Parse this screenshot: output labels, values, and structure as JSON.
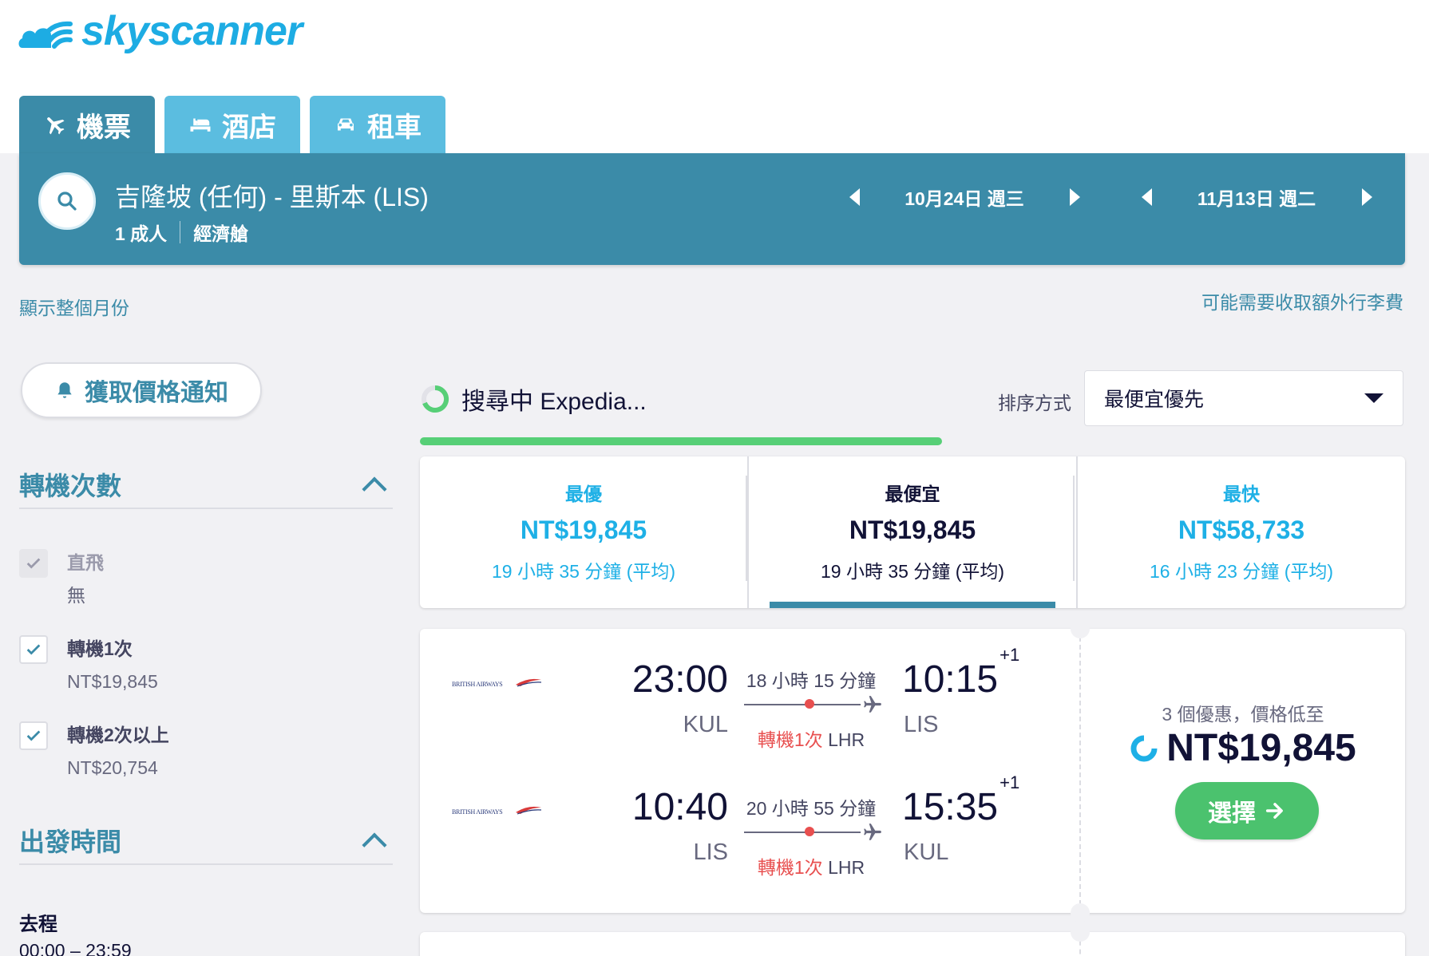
{
  "brand": {
    "name": "skyscanner",
    "color": "#1dace3"
  },
  "tabs": [
    {
      "label": "機票",
      "icon": "plane-icon",
      "active": true
    },
    {
      "label": "酒店",
      "icon": "bed-icon",
      "active": false
    },
    {
      "label": "租車",
      "icon": "car-icon",
      "active": false
    }
  ],
  "search": {
    "route": "吉隆坡 (任何) - 里斯本 (LIS)",
    "passengers": "1 成人",
    "cabin": "經濟艙",
    "depart_date": "10月24日 週三",
    "return_date": "11月13日 週二"
  },
  "links": {
    "show_month": "顯示整個月份",
    "baggage_fee": "可能需要收取額外行李費"
  },
  "price_alert": {
    "label": "獲取價格通知"
  },
  "filters": {
    "stops": {
      "title": "轉機次數",
      "options": [
        {
          "label": "直飛",
          "price": "無",
          "checked": true,
          "disabled": true
        },
        {
          "label": "轉機1次",
          "price": "NT$19,845",
          "checked": true,
          "disabled": false
        },
        {
          "label": "轉機2次以上",
          "price": "NT$20,754",
          "checked": true,
          "disabled": false
        }
      ]
    },
    "departure_time": {
      "title": "出發時間",
      "leg_label": "去程",
      "range": "00:00 – 23:59"
    }
  },
  "status": {
    "searching": "搜尋中 Expedia...",
    "progress": 0.53
  },
  "sort": {
    "label": "排序方式",
    "selected": "最便宜優先"
  },
  "summary": [
    {
      "title": "最優",
      "price": "NT$19,845",
      "duration": "19 小時 35 分鐘 (平均)",
      "active": false
    },
    {
      "title": "最便宜",
      "price": "NT$19,845",
      "duration": "19 小時 35 分鐘 (平均)",
      "active": true
    },
    {
      "title": "最快",
      "price": "NT$58,733",
      "duration": "16 小時 23 分鐘 (平均)",
      "active": false
    }
  ],
  "results": [
    {
      "airline": "BRITISH AIRWAYS",
      "legs": [
        {
          "dep_time": "23:00",
          "dep_code": "KUL",
          "arr_time": "10:15",
          "arr_offset": "+1",
          "arr_code": "LIS",
          "duration": "18 小時 15 分鐘",
          "stops": "轉機1次",
          "via": "LHR"
        },
        {
          "dep_time": "10:40",
          "dep_code": "LIS",
          "arr_time": "15:35",
          "arr_offset": "+1",
          "arr_code": "KUL",
          "duration": "20 小時 55 分鐘",
          "stops": "轉機1次",
          "via": "LHR"
        }
      ],
      "deal_text": "3 個優惠，價格低至",
      "price": "NT$19,845",
      "select_label": "選擇"
    }
  ],
  "colors": {
    "primary": "#3b8ba8",
    "accent_blue": "#1eb0e6",
    "green": "#4bc26e",
    "stop_red": "#e84f4f"
  }
}
